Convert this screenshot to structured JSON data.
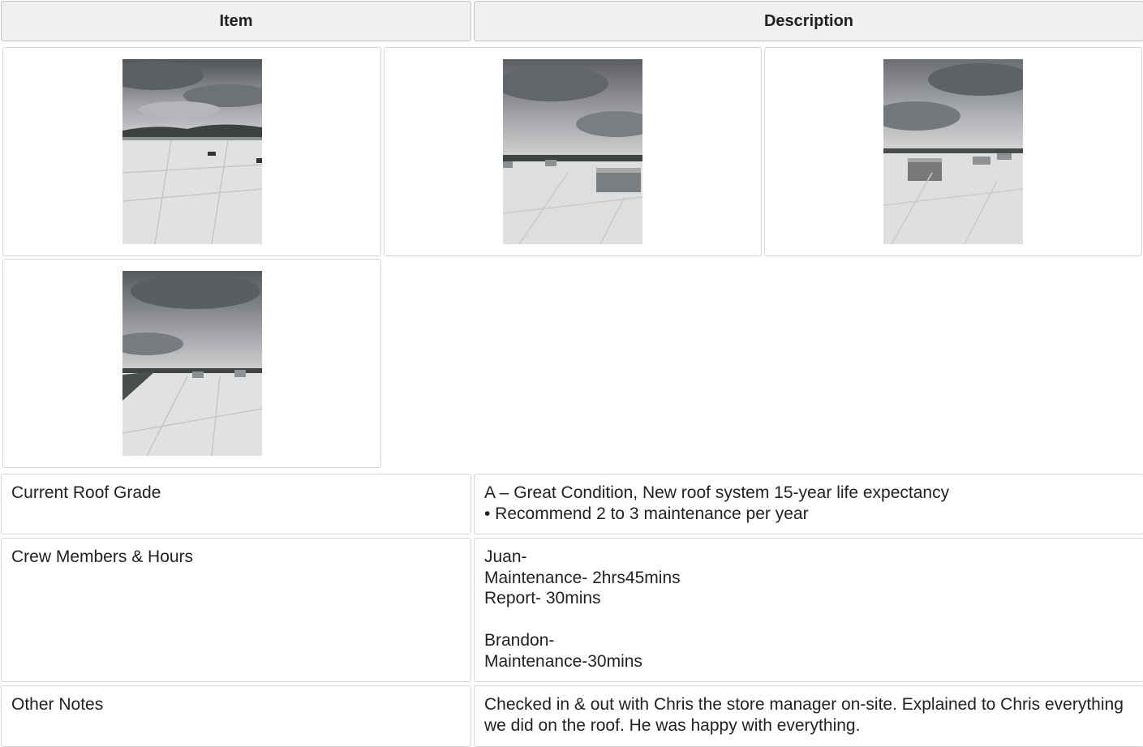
{
  "header": {
    "item_label": "Item",
    "description_label": "Description"
  },
  "photos": [
    {
      "icon": "roof-photo-icon",
      "subject": "roof-view-with-hills"
    },
    {
      "icon": "roof-photo-icon",
      "subject": "roof-view-with-hvac-unit"
    },
    {
      "icon": "roof-photo-icon",
      "subject": "roof-view-with-hvac-units"
    },
    {
      "icon": "roof-photo-icon",
      "subject": "roof-view-with-parapet"
    }
  ],
  "rows": [
    {
      "item": "Current Roof Grade",
      "description": "A – Great Condition, New roof system 15-year life expectancy\n• Recommend 2 to 3 maintenance per year"
    },
    {
      "item": "Crew Members & Hours",
      "description": "Juan-\nMaintenance- 2hrs45mins\nReport- 30mins\n\nBrandon-\nMaintenance-30mins"
    },
    {
      "item": "Other Notes",
      "description": "Checked in & out with Chris the store manager on-site. Explained to Chris everything we did on the roof. He was happy with everything."
    }
  ],
  "colors": {
    "header_bg": "#f0f0f0",
    "border": "#d6d6d6",
    "sky": "#8a8d92",
    "roof": "#dfe1e2"
  }
}
